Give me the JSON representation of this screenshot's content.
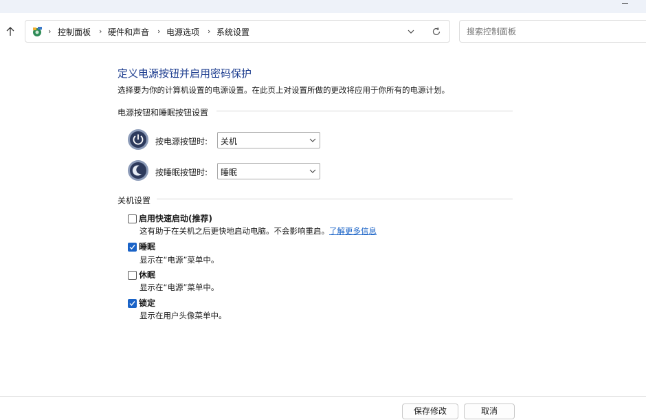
{
  "address_bar": {
    "breadcrumbs": [
      "控制面板",
      "硬件和声音",
      "电源选项",
      "系统设置"
    ]
  },
  "search": {
    "placeholder": "搜索控制面板"
  },
  "main": {
    "title": "定义电源按钮并启用密码保护",
    "description": "选择要为你的计算机设置的电源设置。在此页上对设置所做的更改将应用于你所有的电源计划。",
    "power_section": {
      "heading": "电源按钮和睡眠按钮设置",
      "power_button": {
        "label": "按电源按钮时:",
        "value": "关机"
      },
      "sleep_button": {
        "label": "按睡眠按钮时:",
        "value": "睡眠"
      }
    },
    "shutdown_section": {
      "heading": "关机设置",
      "options": [
        {
          "title": "启用快速启动(推荐)",
          "desc": "这有助于在关机之后更快地启动电脑。不会影响重启。",
          "link": "了解更多信息",
          "checked": false
        },
        {
          "title": "睡眠",
          "desc": "显示在“电源”菜单中。",
          "checked": true
        },
        {
          "title": "休眠",
          "desc": "显示在“电源”菜单中。",
          "checked": false
        },
        {
          "title": "锁定",
          "desc": "显示在用户头像菜单中。",
          "checked": true
        }
      ]
    }
  },
  "footer": {
    "save_label": "保存修改",
    "cancel_label": "取消"
  },
  "colors": {
    "title": "#1d3d8f",
    "accent": "#1a63c7"
  }
}
